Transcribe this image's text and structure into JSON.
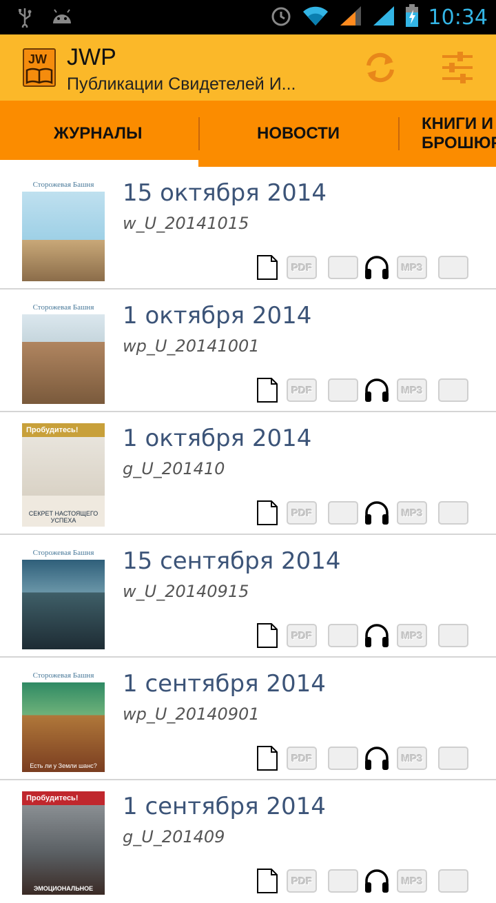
{
  "status_bar": {
    "time": "10:34"
  },
  "app": {
    "title": "JWP",
    "subtitle": "Публикации Свидетелей И..."
  },
  "tabs": [
    {
      "label": "ЖУРНАЛЫ"
    },
    {
      "label": "НОВОСТИ"
    },
    {
      "label": "КНИГИ И БРОШЮРЫ"
    }
  ],
  "items": [
    {
      "title": "15 октября 2014",
      "code": "w_U_20141015",
      "cover_title": "Сторожевая Башня",
      "cover_caption": ""
    },
    {
      "title": "1 октября 2014",
      "code": "wp_U_20141001",
      "cover_title": "Сторожевая Башня",
      "cover_caption": ""
    },
    {
      "title": "1 октября 2014",
      "code": "g_U_201410",
      "cover_title": "Пробудитесь!",
      "cover_caption": "СЕКРЕТ НАСТОЯЩЕГО УСПЕХА"
    },
    {
      "title": "15 сентября 2014",
      "code": "w_U_20140915",
      "cover_title": "Сторожевая Башня",
      "cover_caption": ""
    },
    {
      "title": "1 сентября 2014",
      "code": "wp_U_20140901",
      "cover_title": "Сторожевая Башня",
      "cover_caption": "Есть ли у Земли шанс?"
    },
    {
      "title": "1 сентября 2014",
      "code": "g_U_201409",
      "cover_title": "Пробудитесь!",
      "cover_caption": "ЭМОЦИОНАЛЬНОЕ"
    }
  ],
  "badges": {
    "pdf": "PDF",
    "mp3": "MP3"
  },
  "colors": {
    "actionbar": "#fbb829",
    "tabs": "#fb8c00",
    "title_text": "#3c5478"
  }
}
